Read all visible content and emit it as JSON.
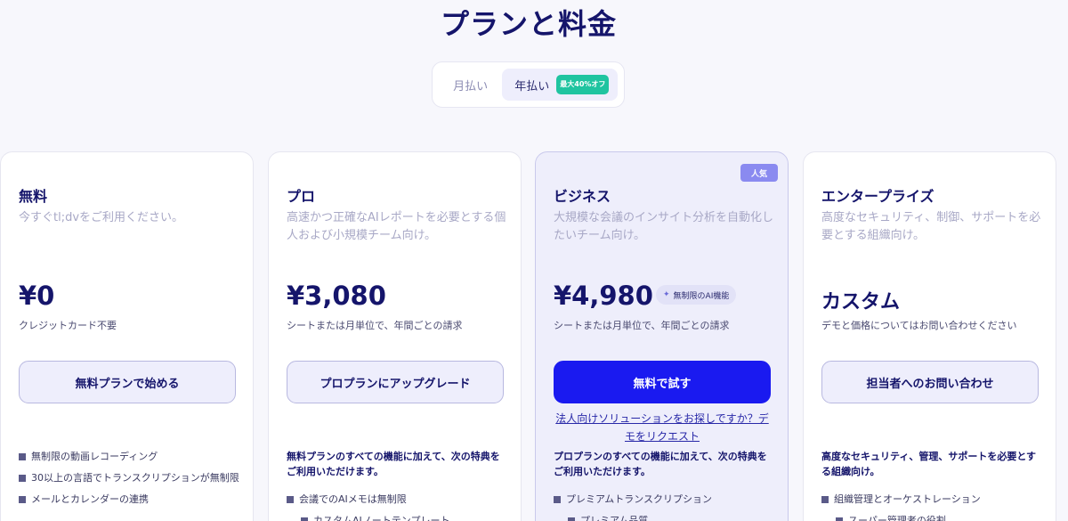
{
  "page": {
    "title": "プランと料金"
  },
  "billing_toggle": {
    "monthly_label": "月払い",
    "yearly_label": "年払い",
    "discount_badge": "最大40%オフ"
  },
  "plans": [
    {
      "name": "無料",
      "description": "今すぐtl;dvをご利用ください。",
      "price": "¥0",
      "note": "クレジットカード不要",
      "cta": "無料プランで始める",
      "features": [
        "無制限の動画レコーディング",
        "30以上の言語でトランスクリプションが無制限",
        "メールとカレンダーの連携"
      ]
    },
    {
      "name": "プロ",
      "description": "高速かつ正確なAIレポートを必要とする個人および小規模チーム向け。",
      "price": "¥3,080",
      "note": "シートまたは月単位で、年間ごとの請求",
      "cta": "プロプランにアップグレード",
      "features_intro": "無料プランのすべての機能に加えて、次の特典をご利用いただけます。",
      "features": [
        "会議でのAIメモは無制限",
        "カスタムAIノートテンプレート"
      ]
    },
    {
      "name": "ビジネス",
      "badge": "人気",
      "description": "大規模な会議のインサイト分析を自動化したいチーム向け。",
      "price": "¥4,980",
      "ai_chip": "無制限のAI機能",
      "note": "シートまたは月単位で、年間ごとの請求",
      "cta": "無料で試す",
      "enterprise_link": "法人向けソリューションをお探しですか？デモをリクエスト",
      "features_intro": "プロプランのすべての機能に加えて、次の特典をご利用いただけます。",
      "features": [
        "プレミアムトランスクリプション",
        "プレミアム品質"
      ]
    },
    {
      "name": "エンタープライズ",
      "description": "高度なセキュリティ、制御、サポートを必要とする組織向け。",
      "price": "カスタム",
      "note": "デモと価格についてはお問い合わせください",
      "cta": "担当者へのお問い合わせ",
      "features_intro": "高度なセキュリティ、管理、サポートを必要とする組織向け。",
      "features": [
        "組織管理とオーケストレーション",
        "スーパー管理者の役割"
      ]
    }
  ],
  "colors": {
    "accent": "#1a1af0",
    "badge_green": "#1fc4a0",
    "popular_badge": "#8a8af0",
    "title_navy": "#15156b"
  }
}
